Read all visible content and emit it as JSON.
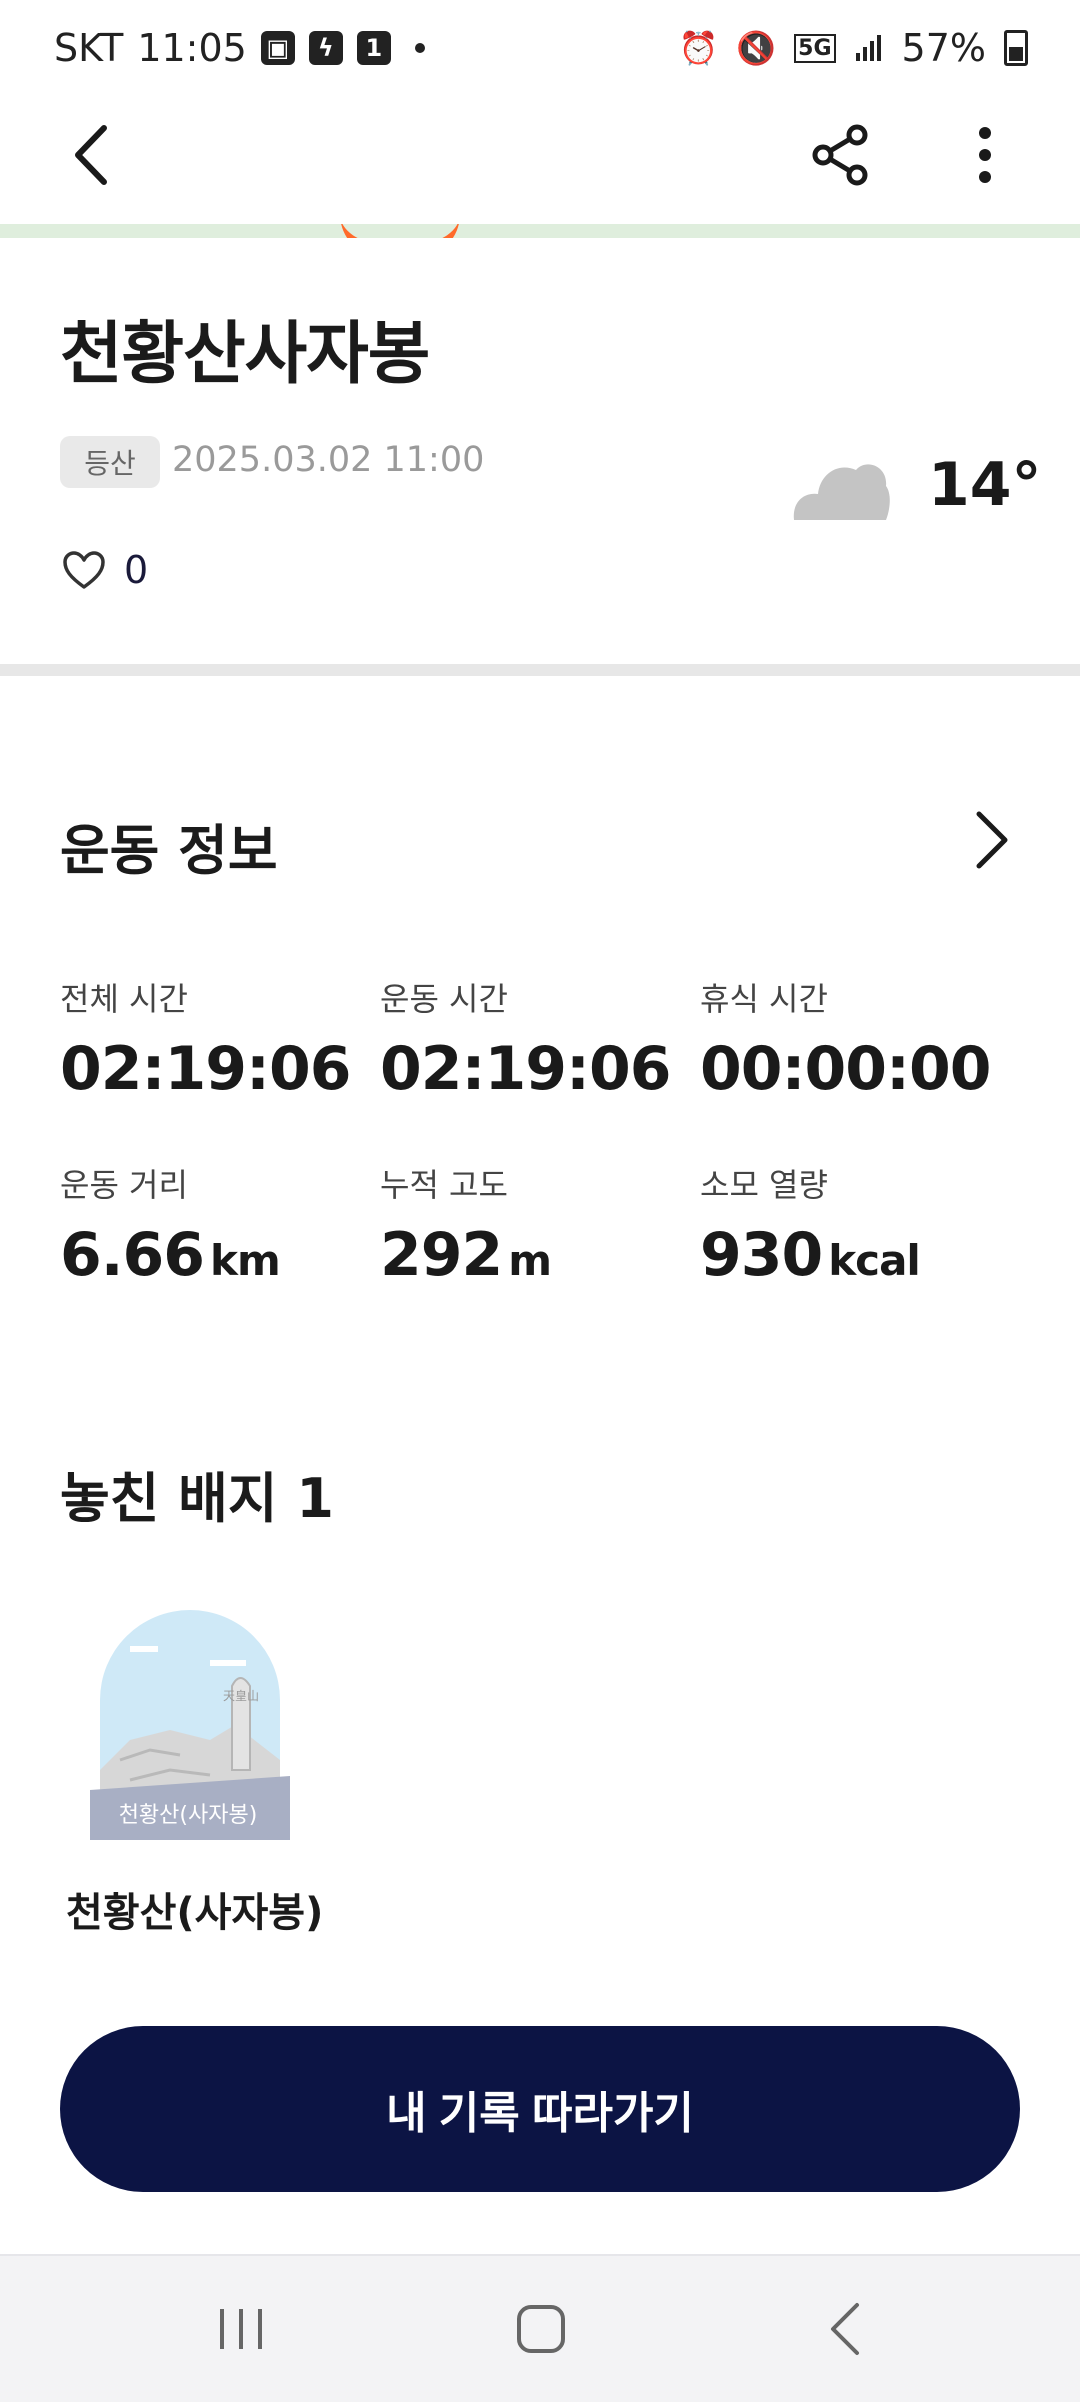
{
  "status_bar": {
    "carrier": "SKT",
    "time": "11:05",
    "notif_badge": "1",
    "network": "5G",
    "battery": "57%"
  },
  "header": {
    "back_icon": "chevron-left-icon",
    "share_icon": "share-icon",
    "more_icon": "more-vertical-icon"
  },
  "activity": {
    "title": "천황산사자봉",
    "category": "등산",
    "datetime": "2025.03.02 11:00",
    "likes": "0",
    "weather_icon": "cloud-icon",
    "temperature": "14°"
  },
  "exercise": {
    "section_title": "운동 정보",
    "stats": [
      {
        "label": "전체 시간",
        "value": "02:19:06",
        "unit": ""
      },
      {
        "label": "운동 시간",
        "value": "02:19:06",
        "unit": ""
      },
      {
        "label": "휴식 시간",
        "value": "00:00:00",
        "unit": ""
      },
      {
        "label": "운동 거리",
        "value": "6.66",
        "unit": "km"
      },
      {
        "label": "누적 고도",
        "value": "292",
        "unit": "m"
      },
      {
        "label": "소모 열량",
        "value": "930",
        "unit": "kcal"
      }
    ]
  },
  "badges": {
    "section_title": "놓친 배지 1",
    "items": [
      {
        "name": "천황산(사자봉)",
        "image_text": "천황산(사자봉)",
        "stone_text": "天皇山"
      }
    ]
  },
  "follow_button": {
    "label": "내 기록 따라가기"
  },
  "colors": {
    "primary_button": "#0c1444",
    "route": "#ff6a2a",
    "map_bg": "#dfeedd"
  }
}
